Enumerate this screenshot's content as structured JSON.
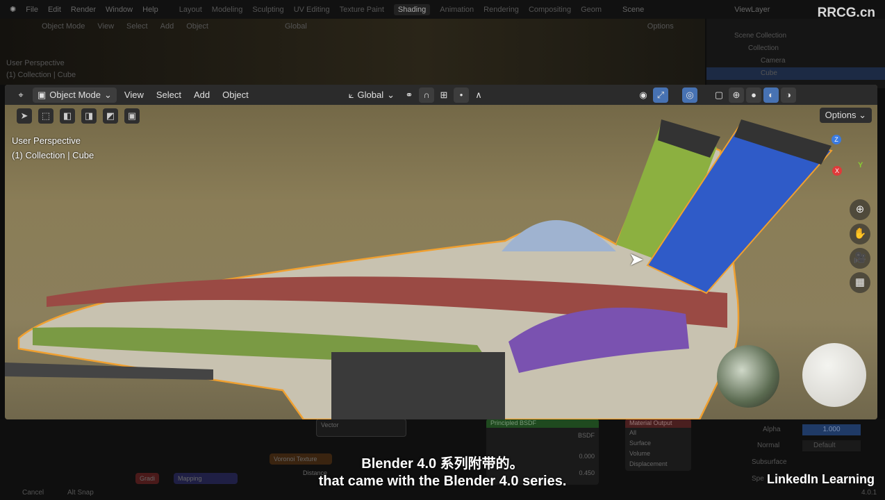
{
  "menu": [
    "File",
    "Edit",
    "Render",
    "Window",
    "Help"
  ],
  "workspaces": [
    "Layout",
    "Modeling",
    "Sculpting",
    "UV Editing",
    "Texture Paint",
    "Shading",
    "Animation",
    "Rendering",
    "Compositing",
    "Geom"
  ],
  "active_workspace": "Shading",
  "scene": "Scene",
  "view_layer": "ViewLayer",
  "watermark": "RRCG.cn",
  "header": {
    "mode": "Object Mode",
    "menus": [
      "View",
      "Select",
      "Add",
      "Object"
    ],
    "orientation": "Global",
    "options": "Options"
  },
  "viewport": {
    "perspective": "User Perspective",
    "collection": "(1) Collection | Cube",
    "axes": {
      "z": "Z",
      "y": "Y",
      "x": "X"
    }
  },
  "outliner": {
    "root": "Scene Collection",
    "items": [
      "Collection",
      "Camera",
      "Cube"
    ]
  },
  "nodes": {
    "vector": "Vector",
    "voronoi": "Voronoi Texture",
    "distance": "Distance",
    "mapping": "Mapping",
    "bsdf_title": "Principled BSDF",
    "bsdf": "BSDF",
    "material_output": "Material Output",
    "target": "All",
    "surface": "Surface",
    "volume": "Volume",
    "displacement": "Displacement",
    "value1": "0.000",
    "value2": "0.450",
    "tag": "Gradi"
  },
  "properties": {
    "alpha_label": "Alpha",
    "alpha_value": "1.000",
    "normal_label": "Normal",
    "normal_value": "Default",
    "subsurface": "Subsurface",
    "specular": "Spe"
  },
  "status": {
    "cancel": "Cancel",
    "snap": "Alt Snap",
    "version": "4.0.1"
  },
  "subtitle": {
    "line1": "Blender 4.0 系列附带的。",
    "line2": "that came with the Blender 4.0 series."
  },
  "brand": "LinkedIn Learning",
  "colors": {
    "accent": "#4772b3",
    "outline": "#f0a030"
  }
}
